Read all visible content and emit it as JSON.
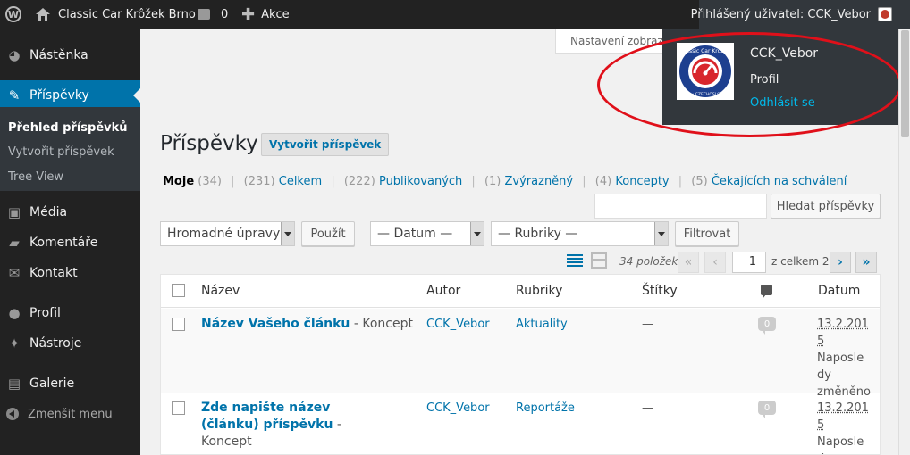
{
  "adminbar": {
    "site_name": "Classic Car Krôžek Brno",
    "comments_count": "0",
    "new_label": "Akce",
    "account_greeting": "Přihlášený uživatel: CCK_Vebor"
  },
  "sidebar": {
    "items": [
      {
        "label": "Nástěnka",
        "icon": "dashboard-icon"
      },
      {
        "label": "Příspěvky",
        "icon": "pin-icon"
      },
      {
        "label": "Média",
        "icon": "media-icon"
      },
      {
        "label": "Komentáře",
        "icon": "comment-icon"
      },
      {
        "label": "Kontakt",
        "icon": "mail-icon"
      },
      {
        "label": "Profil",
        "icon": "user-icon"
      },
      {
        "label": "Nástroje",
        "icon": "wrench-icon"
      },
      {
        "label": "Galerie",
        "icon": "gallery-icon"
      }
    ],
    "submenu": [
      "Přehled příspěvků",
      "Vytvořit příspěvek",
      "Tree View"
    ],
    "collapse_label": "Zmenšit menu"
  },
  "screen_options": "Nastavení zobrazení",
  "page": {
    "title": "Příspěvky",
    "add_new": "Vytvořit příspěvek"
  },
  "filters": {
    "mine": "Moje",
    "mine_count": "(34)",
    "all_count": "(231)",
    "all": "Celkem",
    "published_count": "(222)",
    "published": "Publikovaných",
    "sticky_count": "(1)",
    "sticky": "Zvýrazněný",
    "drafts_count": "(4)",
    "drafts": "Koncepty",
    "pending_count": "(5)",
    "pending": "Čekajících na schválení"
  },
  "search": {
    "button": "Hledat příspěvky",
    "value": ""
  },
  "toolbar": {
    "bulk": "Hromadné úpravy",
    "apply": "Použít",
    "date": "— Datum —",
    "category": "— Rubriky —",
    "filter": "Filtrovat"
  },
  "pagination": {
    "items": "34 položek",
    "first": "«",
    "prev": "‹",
    "current": "1",
    "of": "z celkem 2",
    "next": "›",
    "last": "»"
  },
  "table": {
    "headers": {
      "title": "Název",
      "author": "Autor",
      "categories": "Rubriky",
      "tags": "Štítky",
      "date": "Datum"
    },
    "rows": [
      {
        "title": "Název Vašeho článku",
        "state": " - Koncept",
        "author": "CCK_Vebor",
        "category": "Aktuality",
        "tags": "—",
        "comments": "0",
        "date": "13.2.2015",
        "date_status": "Naposledy změněno"
      },
      {
        "title": "Zde napište název (článku) příspěvku",
        "state": " - Koncept",
        "author": "CCK_Vebor",
        "category": "Reportáže",
        "tags": "—",
        "comments": "0",
        "date": "13.2.2015",
        "date_status": "Naposledy"
      }
    ]
  },
  "account_dropdown": {
    "name": "CCK_Vebor",
    "profile": "Profil",
    "logout": "Odhlásit se",
    "avatar_text": "Classic Car Krôžek",
    "avatar_subtext": "BRNO • CZECHOSLOVAKIA"
  },
  "colors": {
    "adminbar_bg": "#222222",
    "accent": "#0073aa",
    "link_highlight": "#00b9eb",
    "annotation_red": "#e0101a"
  }
}
